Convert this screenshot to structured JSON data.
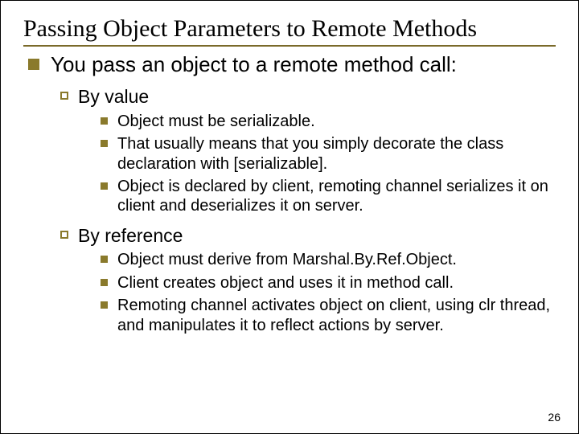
{
  "title": "Passing Object Parameters to Remote Methods",
  "level1": "You pass an object to a remote method call:",
  "byValue": {
    "heading": "By value",
    "items": [
      "Object must be serializable.",
      "That usually means that you simply decorate the class declaration with [serializable].",
      "Object is declared by client, remoting channel serializes it on client and deserializes it on server."
    ]
  },
  "byReference": {
    "heading": "By reference",
    "items": [
      "Object must derive from Marshal.By.Ref.Object.",
      "Client creates object and uses it in method call.",
      "Remoting channel activates object on client, using clr thread, and manipulates it to reflect actions by server."
    ]
  },
  "pageNumber": "26"
}
